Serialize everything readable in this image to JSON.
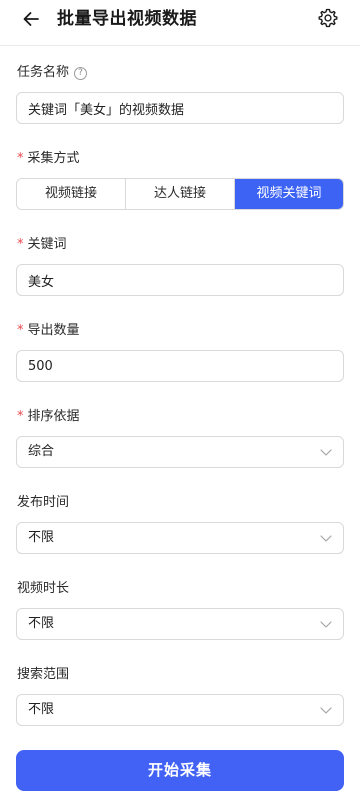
{
  "header": {
    "title": "批量导出视频数据",
    "back_icon": "arrow-left-icon",
    "settings_icon": "gear-icon"
  },
  "task_name": {
    "label": "任务名称",
    "help_icon": "question-circle-icon",
    "help_glyph": "?",
    "value": "关键词「美女」的视频数据"
  },
  "collect_method": {
    "label": "采集方式",
    "options": [
      "视频链接",
      "达人链接",
      "视频关键词"
    ],
    "selected": "视频关键词"
  },
  "keyword": {
    "label": "关键词",
    "value": "美女"
  },
  "export_count": {
    "label": "导出数量",
    "value": "500"
  },
  "sort_by": {
    "label": "排序依据",
    "value": "综合"
  },
  "publish_time": {
    "label": "发布时间",
    "value": "不限"
  },
  "video_duration": {
    "label": "视频时长",
    "value": "不限"
  },
  "search_scope": {
    "label": "搜索范围",
    "value": "不限"
  },
  "required_mark": "*",
  "submit": {
    "label": "开始采集"
  },
  "colors": {
    "accent": "#4262f6",
    "required": "#e5484d"
  }
}
